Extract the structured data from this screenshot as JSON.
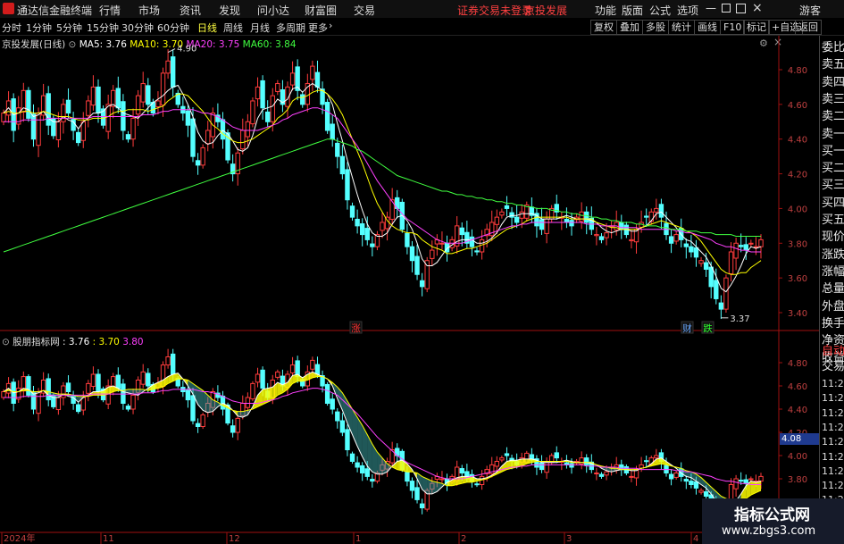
{
  "titlebar": {
    "app_name": "通达信金融终端",
    "menu": [
      "行情",
      "市场",
      "资讯",
      "发现",
      "问小达",
      "财富圈",
      "交易"
    ],
    "status_left": "证券交易未登录",
    "status_right": "京投发展",
    "right_menu": [
      "功能",
      "版面",
      "公式",
      "选项"
    ],
    "guest": "游客"
  },
  "toolbar": {
    "periods": [
      "分时",
      "1分钟",
      "5分钟",
      "15分钟",
      "30分钟",
      "60分钟",
      "日线",
      "周线",
      "月线",
      "多周期",
      "更多"
    ],
    "selected": "日线",
    "right_buttons": [
      "复权",
      "叠加",
      "多股",
      "统计",
      "画线",
      "F10",
      "标记",
      "+自选",
      "返回"
    ]
  },
  "main_chart": {
    "stock": "京投发展(日线)",
    "ma_labels": [
      {
        "text": "MA5: 3.76",
        "color": "#ffffff"
      },
      {
        "text": "MA10: 3.70",
        "color": "#ffff00"
      },
      {
        "text": "MA20: 3.75",
        "color": "#ff40ff"
      },
      {
        "text": "MA60: 3.84",
        "color": "#40ff40"
      }
    ],
    "high_marker": "4.90",
    "low_marker": "3.37",
    "tags": [
      {
        "text": "涨",
        "color": "#ff3030"
      },
      {
        "text": "财",
        "color": "#6aa8ff"
      },
      {
        "text": "跌",
        "color": "#30ff30"
      }
    ]
  },
  "sub_chart": {
    "name": "股朋指标网",
    "values": [
      {
        "text": ": 3.76",
        "color": "#ffffff"
      },
      {
        "text": ": 3.70",
        "color": "#ffff00"
      },
      {
        "text": "3.80",
        "color": "#ff40ff"
      }
    ],
    "current_price": "4.08"
  },
  "right_panel": {
    "items": [
      "委比",
      "卖五",
      "卖四",
      "卖三",
      "卖二",
      "卖一",
      "买一",
      "买二",
      "买三",
      "买四",
      "买五",
      "现价",
      "涨跌",
      "涨幅",
      "总量",
      "外盘",
      "换手",
      "净资",
      "收益"
    ],
    "tabs": [
      "自动",
      "交易"
    ],
    "times": [
      "11:29",
      "11:29",
      "11:29",
      "11:29",
      "11:29",
      "11:29",
      "11:29",
      "11:29",
      "11:29",
      "11:29"
    ]
  },
  "watermark": {
    "line1": "指标公式网",
    "line2": "www.zbgs3.com"
  },
  "chart_data": {
    "type": "candlestick",
    "title": "京投发展(日线)",
    "x_labels": [
      "2024年",
      "11",
      "12",
      "1",
      "2",
      "3",
      "4"
    ],
    "price_axis": [
      "4.80",
      "4.60",
      "4.40",
      "4.20",
      "4.00",
      "3.80",
      "3.60",
      "3.40"
    ],
    "sub_axis": [
      "4.80",
      "4.60",
      "4.40",
      "4.20",
      "4.00",
      "3.80"
    ],
    "ylim": [
      3.33,
      4.95
    ],
    "closes": [
      4.55,
      4.62,
      4.45,
      4.58,
      4.68,
      4.52,
      4.4,
      4.55,
      4.65,
      4.48,
      4.42,
      4.5,
      4.6,
      4.55,
      4.45,
      4.38,
      4.5,
      4.62,
      4.7,
      4.55,
      4.48,
      4.6,
      4.68,
      4.58,
      4.45,
      4.4,
      4.52,
      4.65,
      4.72,
      4.6,
      4.55,
      4.62,
      4.78,
      4.85,
      4.7,
      4.6,
      4.55,
      4.48,
      4.3,
      4.25,
      4.35,
      4.45,
      4.55,
      4.5,
      4.4,
      4.28,
      4.2,
      4.32,
      4.45,
      4.5,
      4.62,
      4.7,
      4.58,
      4.5,
      4.65,
      4.72,
      4.6,
      4.7,
      4.78,
      4.68,
      4.6,
      4.72,
      4.82,
      4.7,
      4.6,
      4.45,
      4.4,
      4.3,
      4.2,
      4.05,
      3.95,
      3.9,
      3.85,
      3.82,
      3.78,
      3.85,
      3.92,
      3.95,
      4.05,
      4.0,
      3.88,
      3.78,
      3.7,
      3.62,
      3.55,
      3.7,
      3.76,
      3.82,
      3.8,
      3.75,
      3.82,
      3.9,
      3.85,
      3.8,
      3.78,
      3.75,
      3.82,
      3.88,
      3.92,
      3.95,
      3.98,
      4.0,
      3.95,
      3.92,
      3.98,
      4.02,
      3.96,
      3.9,
      3.88,
      3.94,
      4.0,
      3.98,
      3.95,
      3.92,
      3.9,
      3.95,
      3.98,
      3.92,
      3.88,
      3.85,
      3.82,
      3.86,
      3.9,
      3.92,
      3.88,
      3.85,
      3.82,
      3.88,
      3.92,
      3.95,
      3.98,
      4.0,
      3.95,
      3.85,
      3.8,
      3.85,
      3.82,
      3.78,
      3.75,
      3.72,
      3.7,
      3.65,
      3.55,
      3.48,
      3.42,
      3.6,
      3.75,
      3.8,
      3.78,
      3.76,
      3.8,
      3.78,
      3.82
    ],
    "ma5": [
      4.55,
      4.58,
      4.54,
      4.55,
      4.58,
      4.57,
      4.53,
      4.54,
      4.56,
      4.52,
      4.5,
      4.5,
      4.53,
      4.51,
      4.5,
      4.46,
      4.5,
      4.52,
      4.55,
      4.55,
      4.56,
      4.59,
      4.6,
      4.58,
      4.55,
      4.54,
      4.53,
      4.52,
      4.55,
      4.58,
      4.61,
      4.63,
      4.65,
      4.68,
      4.7,
      4.71,
      4.66,
      4.6,
      4.53,
      4.44,
      4.39,
      4.37,
      4.38,
      4.42,
      4.45,
      4.43,
      4.39,
      4.34,
      4.33,
      4.35,
      4.42,
      4.52,
      4.57,
      4.58,
      4.59,
      4.63,
      4.61,
      4.63,
      4.69,
      4.7,
      4.67,
      4.7,
      4.72,
      4.7,
      4.68,
      4.66,
      4.6,
      4.49,
      4.39,
      4.28,
      4.18,
      4.08,
      3.99,
      3.91,
      3.86,
      3.84,
      3.84,
      3.86,
      3.91,
      3.95,
      3.96,
      3.93,
      3.88,
      3.8,
      3.71,
      3.67,
      3.67,
      3.69,
      3.73,
      3.77,
      3.79,
      3.81,
      3.82,
      3.82,
      3.82,
      3.8,
      3.8,
      3.81,
      3.83,
      3.86,
      3.91,
      3.95,
      3.96,
      3.96,
      3.97,
      3.97,
      3.97,
      3.96,
      3.94,
      3.94,
      3.94,
      3.94,
      3.95,
      3.96,
      3.95,
      3.94,
      3.94,
      3.94,
      3.93,
      3.92,
      3.89,
      3.87,
      3.86,
      3.87,
      3.88,
      3.88,
      3.87,
      3.87,
      3.89,
      3.9,
      3.93,
      3.97,
      3.98,
      3.95,
      3.92,
      3.89,
      3.85,
      3.82,
      3.81,
      3.78,
      3.75,
      3.72,
      3.67,
      3.61,
      3.54,
      3.52,
      3.56,
      3.61,
      3.67,
      3.74,
      3.78,
      3.77,
      3.78
    ],
    "ma10": [
      4.55,
      4.56,
      4.55,
      4.55,
      4.56,
      4.56,
      4.55,
      4.55,
      4.56,
      4.55,
      4.54,
      4.53,
      4.53,
      4.53,
      4.52,
      4.51,
      4.51,
      4.51,
      4.52,
      4.52,
      4.52,
      4.53,
      4.55,
      4.56,
      4.56,
      4.57,
      4.57,
      4.57,
      4.57,
      4.56,
      4.57,
      4.58,
      4.59,
      4.62,
      4.64,
      4.66,
      4.66,
      4.65,
      4.62,
      4.59,
      4.56,
      4.52,
      4.48,
      4.46,
      4.43,
      4.41,
      4.39,
      4.38,
      4.38,
      4.39,
      4.4,
      4.42,
      4.44,
      4.46,
      4.48,
      4.52,
      4.54,
      4.57,
      4.62,
      4.64,
      4.64,
      4.65,
      4.67,
      4.68,
      4.68,
      4.66,
      4.63,
      4.59,
      4.54,
      4.47,
      4.4,
      4.33,
      4.26,
      4.18,
      4.1,
      4.03,
      3.98,
      3.93,
      3.9,
      3.88,
      3.87,
      3.86,
      3.86,
      3.85,
      3.82,
      3.8,
      3.78,
      3.77,
      3.76,
      3.74,
      3.74,
      3.75,
      3.76,
      3.77,
      3.77,
      3.78,
      3.79,
      3.8,
      3.82,
      3.84,
      3.86,
      3.88,
      3.89,
      3.9,
      3.91,
      3.93,
      3.94,
      3.95,
      3.95,
      3.95,
      3.95,
      3.95,
      3.95,
      3.95,
      3.94,
      3.94,
      3.94,
      3.94,
      3.94,
      3.92,
      3.91,
      3.9,
      3.89,
      3.89,
      3.88,
      3.88,
      3.88,
      3.88,
      3.89,
      3.9,
      3.91,
      3.92,
      3.93,
      3.92,
      3.91,
      3.9,
      3.89,
      3.87,
      3.86,
      3.84,
      3.81,
      3.77,
      3.73,
      3.69,
      3.65,
      3.63,
      3.62,
      3.62,
      3.63,
      3.63,
      3.66,
      3.68,
      3.7
    ],
    "ma20": [
      4.5,
      4.5,
      4.5,
      4.5,
      4.51,
      4.51,
      4.51,
      4.51,
      4.51,
      4.52,
      4.52,
      4.52,
      4.52,
      4.52,
      4.52,
      4.52,
      4.52,
      4.52,
      4.53,
      4.53,
      4.53,
      4.53,
      4.53,
      4.53,
      4.53,
      4.53,
      4.53,
      4.53,
      4.54,
      4.54,
      4.54,
      4.55,
      4.56,
      4.56,
      4.57,
      4.57,
      4.57,
      4.57,
      4.57,
      4.56,
      4.55,
      4.55,
      4.54,
      4.53,
      4.51,
      4.49,
      4.47,
      4.46,
      4.45,
      4.45,
      4.45,
      4.45,
      4.46,
      4.47,
      4.48,
      4.49,
      4.51,
      4.52,
      4.54,
      4.55,
      4.56,
      4.57,
      4.58,
      4.58,
      4.57,
      4.56,
      4.54,
      4.52,
      4.48,
      4.44,
      4.4,
      4.36,
      4.31,
      4.26,
      4.21,
      4.16,
      4.12,
      4.08,
      4.04,
      4.0,
      3.97,
      3.94,
      3.92,
      3.9,
      3.88,
      3.86,
      3.84,
      3.82,
      3.81,
      3.8,
      3.8,
      3.8,
      3.8,
      3.81,
      3.82,
      3.83,
      3.84,
      3.85,
      3.86,
      3.87,
      3.88,
      3.89,
      3.9,
      3.9,
      3.91,
      3.91,
      3.92,
      3.92,
      3.92,
      3.92,
      3.92,
      3.92,
      3.92,
      3.92,
      3.92,
      3.92,
      3.92,
      3.91,
      3.91,
      3.91,
      3.9,
      3.9,
      3.9,
      3.9,
      3.89,
      3.89,
      3.89,
      3.89,
      3.88,
      3.88,
      3.88,
      3.88,
      3.88,
      3.88,
      3.88,
      3.87,
      3.87,
      3.86,
      3.86,
      3.85,
      3.84,
      3.83,
      3.82,
      3.8,
      3.79,
      3.78,
      3.78,
      3.77,
      3.76,
      3.76,
      3.75,
      3.75,
      3.75
    ],
    "ma60": [
      3.75,
      3.76,
      3.77,
      3.78,
      3.79,
      3.8,
      3.81,
      3.82,
      3.83,
      3.84,
      3.85,
      3.86,
      3.87,
      3.88,
      3.89,
      3.9,
      3.91,
      3.92,
      3.93,
      3.94,
      3.95,
      3.96,
      3.97,
      3.98,
      3.99,
      4.0,
      4.01,
      4.02,
      4.03,
      4.04,
      4.05,
      4.06,
      4.07,
      4.08,
      4.09,
      4.1,
      4.11,
      4.12,
      4.13,
      4.14,
      4.15,
      4.16,
      4.17,
      4.18,
      4.19,
      4.2,
      4.21,
      4.22,
      4.23,
      4.24,
      4.25,
      4.26,
      4.27,
      4.28,
      4.29,
      4.3,
      4.31,
      4.32,
      4.33,
      4.34,
      4.35,
      4.36,
      4.37,
      4.38,
      4.39,
      4.4,
      4.4,
      4.39,
      4.38,
      4.37,
      4.36,
      4.34,
      4.33,
      4.31,
      4.29,
      4.27,
      4.25,
      4.23,
      4.21,
      4.19,
      4.18,
      4.17,
      4.16,
      4.15,
      4.14,
      4.13,
      4.12,
      4.11,
      4.1,
      4.1,
      4.09,
      4.08,
      4.08,
      4.07,
      4.07,
      4.06,
      4.06,
      4.05,
      4.05,
      4.04,
      4.04,
      4.03,
      4.03,
      4.02,
      4.02,
      4.01,
      4.01,
      4.0,
      4.0,
      4.0,
      3.99,
      3.99,
      3.98,
      3.98,
      3.97,
      3.97,
      3.96,
      3.96,
      3.95,
      3.95,
      3.94,
      3.94,
      3.93,
      3.93,
      3.92,
      3.92,
      3.92,
      3.91,
      3.91,
      3.9,
      3.9,
      3.9,
      3.89,
      3.89,
      3.88,
      3.88,
      3.88,
      3.87,
      3.87,
      3.87,
      3.86,
      3.86,
      3.86,
      3.85,
      3.85,
      3.85,
      3.85,
      3.84,
      3.84,
      3.84,
      3.84,
      3.84,
      3.84
    ]
  }
}
